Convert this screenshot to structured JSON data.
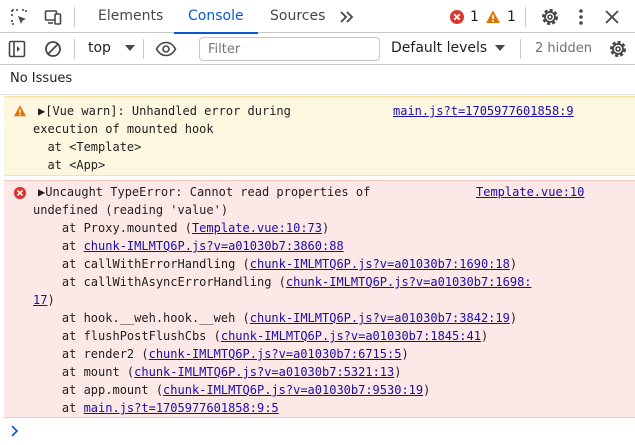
{
  "tabs": {
    "items": [
      "Elements",
      "Console",
      "Sources"
    ],
    "active": "Console",
    "error_count": "1",
    "warning_count": "1"
  },
  "toolbar": {
    "context": "top",
    "filter_placeholder": "Filter",
    "levels": "Default levels",
    "hidden": "2 hidden"
  },
  "issues": {
    "label": "No Issues"
  },
  "warning": {
    "lines": [
      "▶[Vue warn]: Unhandled error during",
      "execution of mounted hook",
      "  at <Template>",
      "  at <App>"
    ],
    "source": "main.js?t=1705977601858:9"
  },
  "error": {
    "line1": "▶Uncaught TypeError: Cannot read properties of",
    "line2": "undefined (reading 'value')",
    "source": "Template.vue:10",
    "stack": [
      {
        "prefix": "    at Proxy.mounted (",
        "link": "Template.vue:10:73",
        "suffix": ")"
      },
      {
        "prefix": "    at ",
        "link": "chunk-IMLMTQ6P.js?v=a01030b7:3860:88",
        "suffix": ""
      },
      {
        "prefix": "    at callWithErrorHandling (",
        "link": "chunk-IMLMTQ6P.js?v=a01030b7:1690:18",
        "suffix": ")"
      },
      {
        "prefix": "    at callWithAsyncErrorHandling (",
        "link": "chunk-IMLMTQ6P.js?v=a01030b7:1698:",
        "suffix": ""
      },
      {
        "prefix": "",
        "link": "17",
        "suffix": ")"
      },
      {
        "prefix": "    at hook.__weh.hook.__weh (",
        "link": "chunk-IMLMTQ6P.js?v=a01030b7:3842:19",
        "suffix": ")"
      },
      {
        "prefix": "    at flushPostFlushCbs (",
        "link": "chunk-IMLMTQ6P.js?v=a01030b7:1845:41",
        "suffix": ")"
      },
      {
        "prefix": "    at render2 (",
        "link": "chunk-IMLMTQ6P.js?v=a01030b7:6715:5",
        "suffix": ")"
      },
      {
        "prefix": "    at mount (",
        "link": "chunk-IMLMTQ6P.js?v=a01030b7:5321:13",
        "suffix": ")"
      },
      {
        "prefix": "    at app.mount (",
        "link": "chunk-IMLMTQ6P.js?v=a01030b7:9530:19",
        "suffix": ")"
      },
      {
        "prefix": "    at ",
        "link": "main.js?t=1705977601858:9:5",
        "suffix": ""
      }
    ]
  },
  "colors": {
    "accent": "#0b57d0",
    "error": "#dc362e",
    "warning": "#e37400",
    "link": "#1a0dab"
  }
}
